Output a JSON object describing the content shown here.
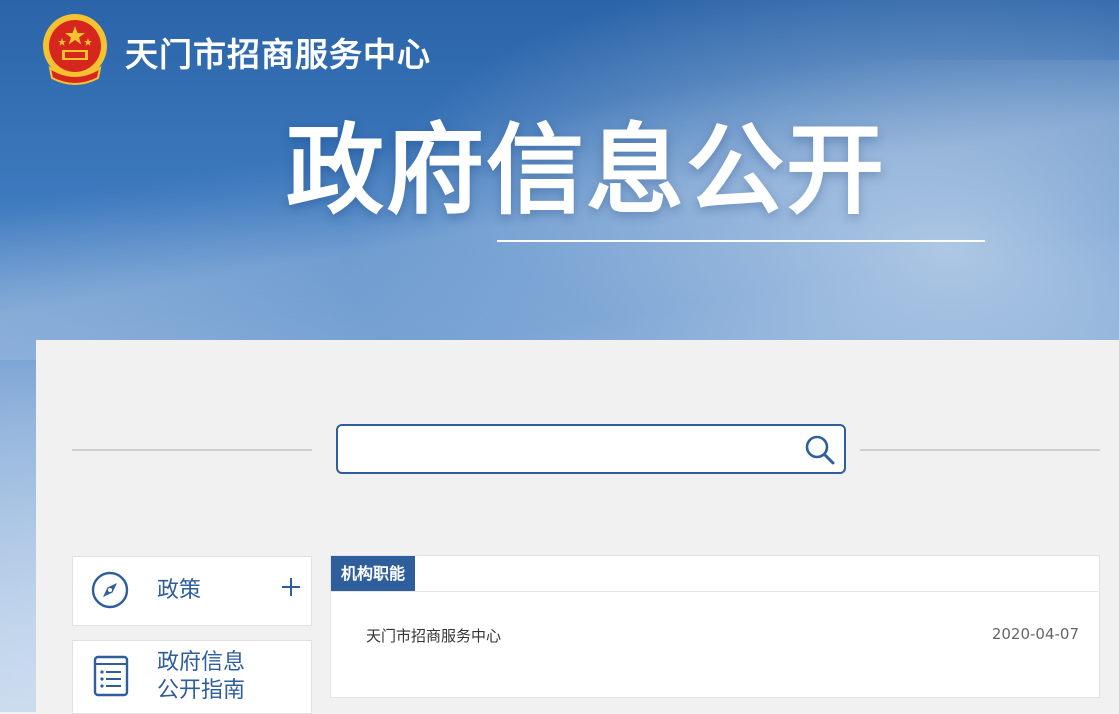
{
  "header": {
    "site_title": "天门市招商服务中心",
    "banner_title": "政府信息公开",
    "emblem_icon": "national-emblem-icon"
  },
  "search": {
    "placeholder": "",
    "value": "",
    "icon": "search-icon"
  },
  "sidebar": {
    "items": [
      {
        "label": "政策",
        "icon": "compass-icon",
        "expand_icon": "plus-icon"
      },
      {
        "label_line1": "政府信息",
        "label_line2": "公开指南",
        "icon": "document-list-icon"
      }
    ]
  },
  "panel": {
    "tab_label": "机构职能",
    "rows": [
      {
        "title": "天门市招商服务中心",
        "date": "2020-04-07"
      }
    ]
  },
  "colors": {
    "accent": "#2f5e9c",
    "banner_top": "#2b64a8",
    "banner_bottom": "#b8cfe9",
    "emblem_red": "#d7261e",
    "emblem_gold": "#f5c332"
  }
}
